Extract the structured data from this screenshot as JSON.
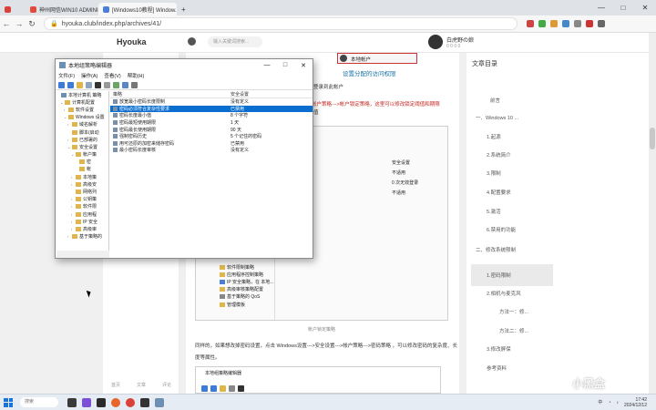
{
  "browser": {
    "tabs": [
      {
        "label": "",
        "active": false
      },
      {
        "label": "神州网信WIN10 ADMINISTR...",
        "active": false
      },
      {
        "label": "[Windows10教程] Window...",
        "active": true
      }
    ],
    "new_tab": "+",
    "window_controls": [
      "—",
      "□",
      "✕"
    ],
    "url": "hyouka.club/index.php/archives/41/"
  },
  "site": {
    "title": "Hyouka",
    "search_placeholder": "输入关键词搜索...",
    "user_name": "白虎野の娘",
    "user_meta": "0 0 0 0",
    "rail_footer": [
      "首页",
      "文章",
      "评论"
    ]
  },
  "article": {
    "top_label": "本地帐户",
    "heading": "设置分配的访问权限",
    "line1_tail": "登录到此帐户",
    "line2": "帐户策略--->帐户锁定策略，这里可以修改锁定阈值和期限",
    "line2_tail": "值",
    "fig_right_head": "安全设置",
    "fig_right_vals": [
      "不适用",
      "0 次无效登录",
      "不适用"
    ],
    "fig_left_items": [
      "软件限制策略",
      "应用程序控制策略",
      "IP 安全策略，在 本地...",
      "高级审核策略配置",
      "基于策略的 QoS",
      "管理模板"
    ],
    "caption": "帐户锁定策略",
    "para": "同样的，如果想改掉密码设置，点击 Windows设置--->安全设置--->帐户策略--->密码策略 ，可以修改密码的复杂度、长",
    "para2": "度等属性。",
    "fig2_title": "本地组策略编辑器"
  },
  "toc": {
    "title": "文章目录",
    "items": [
      "前言",
      "一、Windows 10 ...",
      "1.起源",
      "2.系统简介",
      "3.限制",
      "4.配置要求",
      "5.激活",
      "6.禁用的功能",
      "二、修改系统限制",
      "1.密码限制",
      "2.相机与麦克风",
      "方法一：修...",
      "方法二：修...",
      "3.修改屏保",
      "参考资料"
    ],
    "active_index": 9
  },
  "mmc": {
    "title": "本地组策略编辑器",
    "menu": [
      "文件(F)",
      "操作(A)",
      "查看(V)",
      "帮助(H)"
    ],
    "tree": [
      {
        "label": "本地计算机 策略",
        "indent": 0,
        "arrow": ""
      },
      {
        "label": "计算机配置",
        "indent": 1,
        "arrow": "⌄"
      },
      {
        "label": "软件设置",
        "indent": 2,
        "arrow": "›"
      },
      {
        "label": "Windows 设置",
        "indent": 2,
        "arrow": "⌄"
      },
      {
        "label": "域名解析",
        "indent": 3,
        "arrow": "›"
      },
      {
        "label": "脚本(启动",
        "indent": 3,
        "arrow": ""
      },
      {
        "label": "已部署的",
        "indent": 3,
        "arrow": "›"
      },
      {
        "label": "安全设置",
        "indent": 3,
        "arrow": "⌄"
      },
      {
        "label": "帐户策",
        "indent": 4,
        "arrow": "⌄"
      },
      {
        "label": "密",
        "indent": 5,
        "arrow": ""
      },
      {
        "label": "帐",
        "indent": 5,
        "arrow": ""
      },
      {
        "label": "本地策",
        "indent": 4,
        "arrow": "›"
      },
      {
        "label": "高级安",
        "indent": 4,
        "arrow": "›"
      },
      {
        "label": "网络列",
        "indent": 4,
        "arrow": ""
      },
      {
        "label": "公钥策",
        "indent": 4,
        "arrow": "›"
      },
      {
        "label": "软件限",
        "indent": 4,
        "arrow": "›"
      },
      {
        "label": "应用程",
        "indent": 4,
        "arrow": "›"
      },
      {
        "label": "IP 安全",
        "indent": 4,
        "arrow": "›"
      },
      {
        "label": "高级审",
        "indent": 4,
        "arrow": "›"
      },
      {
        "label": "基于策略的",
        "indent": 3,
        "arrow": "›"
      }
    ],
    "columns": [
      "策略",
      "安全设置"
    ],
    "rows": [
      {
        "policy": "放宽最小密码长度限制",
        "setting": "没有定义",
        "selected": false
      },
      {
        "policy": "密码必须符合复杂性要求",
        "setting": "已禁用",
        "selected": true
      },
      {
        "policy": "密码长度最小值",
        "setting": "8 个字符",
        "selected": false
      },
      {
        "policy": "密码最短使用期限",
        "setting": "1 天",
        "selected": false
      },
      {
        "policy": "密码最长使用期限",
        "setting": "90 天",
        "selected": false
      },
      {
        "policy": "强制密码历史",
        "setting": "5 个记住的密码",
        "selected": false
      },
      {
        "policy": "用可还原的加密来储存密码",
        "setting": "已禁用",
        "selected": false
      },
      {
        "policy": "最小密码长度审核",
        "setting": "没有定义",
        "selected": false
      }
    ]
  },
  "taskbar": {
    "search": "搜索",
    "time": "17:42",
    "date": "2024/12/12",
    "lang": "中"
  },
  "watermark": "小黑盒"
}
